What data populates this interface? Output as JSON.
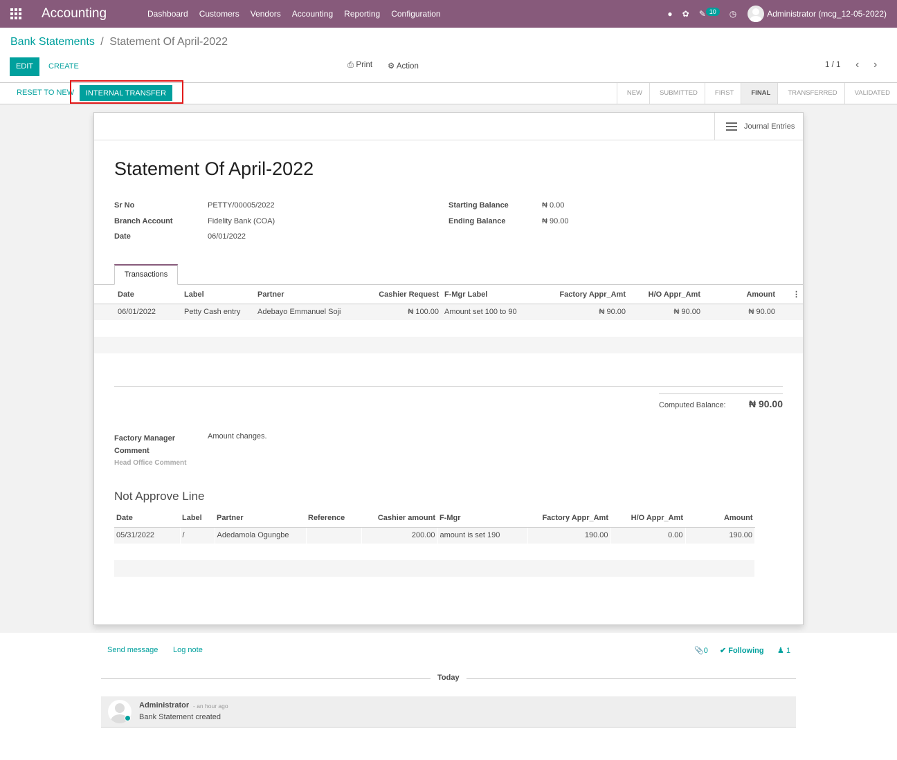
{
  "navbar": {
    "app_name": "Accounting",
    "menu": [
      "Dashboard",
      "Customers",
      "Vendors",
      "Accounting",
      "Reporting",
      "Configuration"
    ],
    "message_count": "10",
    "user": "Administrator (mcg_12-05-2022)"
  },
  "breadcrumb": {
    "parent": "Bank Statements",
    "separator": "/",
    "current": "Statement Of April-2022"
  },
  "buttons": {
    "edit": "EDIT",
    "create": "CREATE",
    "print": "Print",
    "action": "Action",
    "reset": "RESET TO NEW",
    "transfer": "INTERNAL TRANSFER"
  },
  "pager": "1 / 1",
  "stages": [
    "NEW",
    "SUBMITTED",
    "FIRST",
    "FINAL",
    "TRANSFERRED",
    "VALIDATED"
  ],
  "active_stage": "FINAL",
  "journal_button": "Journal Entries",
  "form": {
    "title": "Statement Of April-2022",
    "sr_no_label": "Sr No",
    "sr_no": "PETTY/00005/2022",
    "branch_label": "Branch Account",
    "branch": "Fidelity Bank (COA)",
    "date_label": "Date",
    "date": "06/01/2022",
    "start_label": "Starting Balance",
    "start": "₦ 0.00",
    "end_label": "Ending Balance",
    "end": "₦ 90.00"
  },
  "tab": "Transactions",
  "transactions": {
    "headers": [
      "Date",
      "Label",
      "Partner",
      "Cashier Request",
      "F-Mgr Label",
      "Factory Appr_Amt",
      "H/O Appr_Amt",
      "Amount"
    ],
    "rows": [
      [
        "06/01/2022",
        "Petty Cash entry",
        "Adebayo Emmanuel Soji",
        "₦ 100.00",
        "Amount set 100 to 90",
        "₦ 90.00",
        "₦ 90.00",
        "₦ 90.00"
      ]
    ]
  },
  "computed_label": "Computed Balance:",
  "computed_value": "₦ 90.00",
  "factory_comment_label": "Factory Manager Comment",
  "factory_comment": "Amount changes.",
  "head_office_label": "Head Office Comment",
  "not_approve_title": "Not Approve Line",
  "not_approve": {
    "headers": [
      "Date",
      "Label",
      "Partner",
      "Reference",
      "Cashier amount",
      "F-Mgr",
      "Factory Appr_Amt",
      "H/O Appr_Amt",
      "Amount"
    ],
    "rows": [
      [
        "05/31/2022",
        "/",
        "Adedamola Ogungbe",
        "",
        "200.00",
        "amount is set 190",
        "190.00",
        "0.00",
        "190.00"
      ]
    ]
  },
  "chatter": {
    "send_message": "Send message",
    "log_note": "Log note",
    "attachments": "0",
    "following": "Following",
    "followers": "1",
    "today": "Today",
    "author": "Administrator",
    "time": "- an hour ago",
    "body": "Bank Statement created"
  }
}
